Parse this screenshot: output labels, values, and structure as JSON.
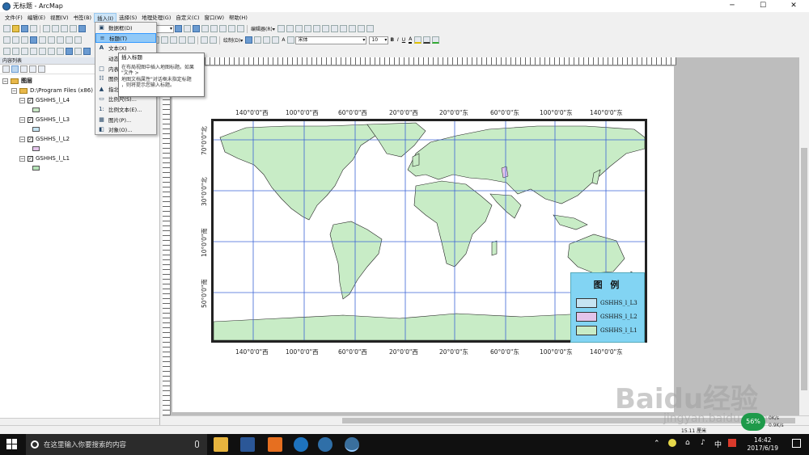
{
  "window": {
    "title": "无标题 - ArcMap",
    "controls": [
      "─",
      "☐",
      "✕"
    ]
  },
  "menubar": [
    "文件(F)",
    "编辑(E)",
    "视图(V)",
    "书签(B)",
    "插入(I)",
    "选择(S)",
    "地理处理(G)",
    "自定义(C)",
    "窗口(W)",
    "帮助(H)"
  ],
  "toolbar": {
    "scale_value": "000",
    "editor_label": "编辑器(R)▾",
    "draw_label": "绘制(D)▾",
    "font_name": "宋体",
    "font_size": "10",
    "bold": "B",
    "italic": "I",
    "underline": "U",
    "text_a": "A"
  },
  "toc": {
    "header": "内容列表",
    "root": "图层",
    "folder": "D:\\Program Files (x86)",
    "layers": [
      {
        "name": "GSHHS_l_L4",
        "color": "#c8e7c4"
      },
      {
        "name": "GSHHS_l_L3",
        "color": "#c6e4f2"
      },
      {
        "name": "GSHHS_l_L2",
        "color": "#e3c4ea"
      },
      {
        "name": "GSHHS_l_L1",
        "color": "#b5e3b7"
      }
    ]
  },
  "insert_menu": {
    "items": [
      {
        "icon": "frame",
        "label": "数据框(D)"
      },
      {
        "icon": "title",
        "label": "标题(T)"
      },
      {
        "icon": "text",
        "label": "文本(X)"
      },
      {
        "icon": "dynamic",
        "label": "动态"
      },
      {
        "icon": "neatline",
        "label": "内表"
      },
      {
        "icon": "legend",
        "label": "图例"
      },
      {
        "icon": "north",
        "label": "指北"
      },
      {
        "icon": "scalebar",
        "label": "比例尺(S)..."
      },
      {
        "icon": "scaletext",
        "label": "比例文本(E)..."
      },
      {
        "icon": "picture",
        "label": "图片(P)..."
      },
      {
        "icon": "object",
        "label": "对象(O)..."
      }
    ]
  },
  "tooltip": {
    "title": "插入标题",
    "lines": [
      "在布局视图中插入地图标题。如果",
      "\"文件 >",
      "地图文档属性\"对话框未指定标题",
      "，则将提示您输入标题。"
    ]
  },
  "map": {
    "top_labels": [
      "140°0'0\"西",
      "100°0'0\"西",
      "60°0'0\"西",
      "20°0'0\"西",
      "20°0'0\"东",
      "60°0'0\"东",
      "100°0'0\"东",
      "140°0'0\"东"
    ],
    "bottom_labels": [
      "140°0'0\"西",
      "100°0'0\"西",
      "60°0'0\"西",
      "20°0'0\"西",
      "20°0'0\"东",
      "60°0'0\"东",
      "100°0'0\"东",
      "140°0'0\"东"
    ],
    "left_labels": [
      "70°0'0\"北",
      "30°0'0\"北",
      "10°0'0\"南",
      "50°0'0\"南"
    ],
    "land_color": "#c8ecc6",
    "grid_color": "#3b64d6"
  },
  "legend": {
    "title": "图 例",
    "items": [
      {
        "label": "GSHHS_l_L3",
        "color": "#c6e4f2"
      },
      {
        "label": "GSHHS_l_L2",
        "color": "#e3c4ea"
      },
      {
        "label": "GSHHS_l_L1",
        "color": "#c8ecc6"
      }
    ]
  },
  "status": {
    "coords": "15.11 厘米"
  },
  "watermark": {
    "main": "Baidu经验",
    "sub": "jingyan.baidu.com"
  },
  "taskbar": {
    "search_placeholder": "在这里输入你要搜索的内容",
    "time": "14:42",
    "date": "2017/6/19",
    "ime": "中",
    "net_percent": "56%",
    "up_speed": "0K/s",
    "down_speed": "0.9K/s"
  }
}
